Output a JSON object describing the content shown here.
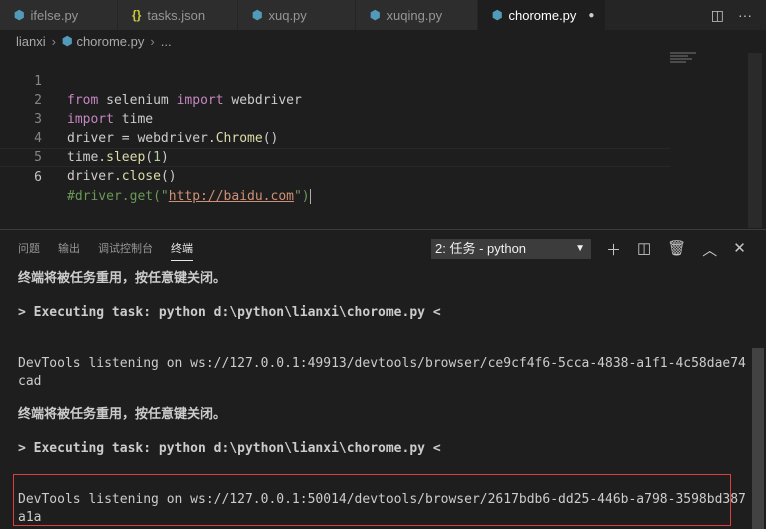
{
  "tabs": [
    {
      "label": "ifelse.py",
      "icon": "python-icon",
      "active": false
    },
    {
      "label": "tasks.json",
      "icon": "json-icon",
      "active": false
    },
    {
      "label": "xuq.py",
      "icon": "python-icon",
      "active": false
    },
    {
      "label": "xuqing.py",
      "icon": "python-icon",
      "active": false
    },
    {
      "label": "chorome.py",
      "icon": "python-icon",
      "active": true
    }
  ],
  "breadcrumb": {
    "folder": "lianxi",
    "file": "chorome.py",
    "tail": "..."
  },
  "editor": {
    "lines": [
      "1",
      "2",
      "3",
      "4",
      "5",
      "6"
    ],
    "code": [
      {
        "a": "from",
        "b": " selenium ",
        "c": "import",
        "d": " webdriver"
      },
      {
        "a": "import",
        "b": " time"
      },
      {
        "a": "driver = webdriver.",
        "b": "Chrome",
        "c": "()"
      },
      {
        "a": "time.",
        "b": "sleep",
        "c": "(",
        "d": "1",
        "e": ")"
      },
      {
        "a": "driver.",
        "b": "close",
        "c": "()"
      },
      {
        "a": "#driver.get(\"",
        "b": "http://baidu.com",
        "c": "\")"
      }
    ]
  },
  "panel": {
    "tabs": [
      "问题",
      "输出",
      "调试控制台",
      "终端"
    ],
    "active_tab": "终端",
    "terminal_select": "2: 任务 - python"
  },
  "terminal": [
    "终端将被任务重用，按任意键关闭。",
    "> Executing task: python d:\\python\\lianxi\\chorome.py <",
    "DevTools listening on ws://127.0.0.1:49913/devtools/browser/ce9cf4f6-5cca-4838-a1f1-4c58dae74",
    "cad",
    "终端将被任务重用，按任意键关闭。",
    "> Executing task: python d:\\python\\lianxi\\chorome.py <",
    "DevTools listening on ws://127.0.0.1:50014/devtools/browser/2617bdb6-dd25-446b-a798-3598bd387",
    "a1a"
  ],
  "colors": {
    "background": "#1e1e1e",
    "highlight_border": "#e03c3c"
  }
}
